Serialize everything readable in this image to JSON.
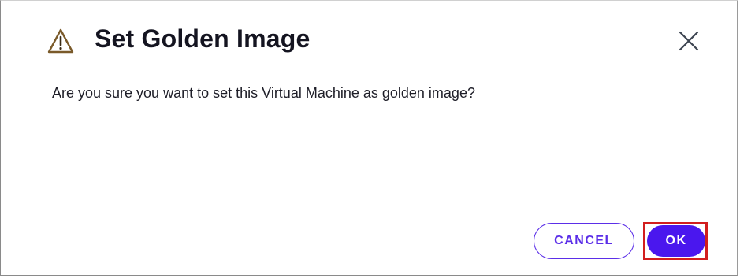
{
  "dialog": {
    "title": "Set Golden Image",
    "title_icon": "warning-triangle-icon",
    "close_icon": "close-icon",
    "message": "Are you sure you want to set this Virtual Machine as golden image?",
    "buttons": {
      "cancel_label": "CANCEL",
      "ok_label": "OK"
    },
    "highlighted_button": "ok"
  },
  "colors": {
    "accent": "#4a17ee",
    "accent_outline": "#5b2ee8",
    "warning_icon": "#7a5a2a",
    "highlight_box": "#d21e1e",
    "text": "#141420"
  }
}
